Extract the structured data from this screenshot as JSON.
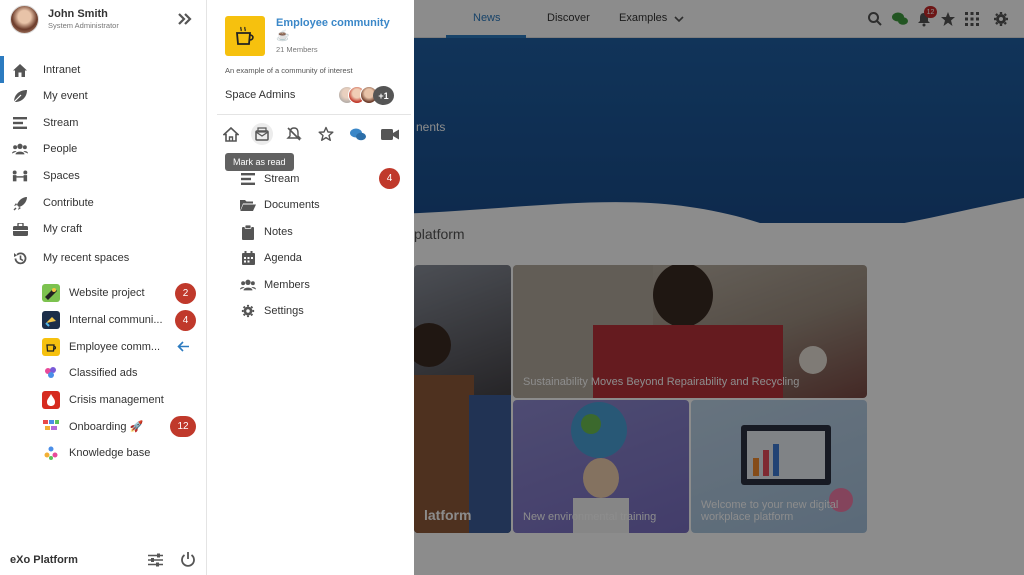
{
  "topbar": {
    "nav": [
      {
        "label": "News",
        "active": true
      },
      {
        "label": "Discover",
        "active": false
      },
      {
        "label": "Examples",
        "active": false
      }
    ],
    "notifications_count": "12"
  },
  "background": {
    "banner_text": "nents",
    "platform_text": "platform",
    "tiles": [
      {
        "caption": "Sustainability Moves Beyond Repairability and Recycling"
      },
      {
        "caption": "New environmental training"
      },
      {
        "caption": "Welcome to your new digital workplace platform"
      },
      {
        "caption": "latform"
      }
    ]
  },
  "user": {
    "name": "John Smith",
    "role": "System Administrator"
  },
  "sidebar": {
    "items": [
      {
        "label": "Intranet",
        "icon": "home-icon"
      },
      {
        "label": "My event",
        "icon": "leaf-icon"
      },
      {
        "label": "Stream",
        "icon": "stream-icon"
      },
      {
        "label": "People",
        "icon": "people-icon"
      },
      {
        "label": "Spaces",
        "icon": "spaces-icon"
      },
      {
        "label": "Contribute",
        "icon": "rocket-icon"
      },
      {
        "label": "My craft",
        "icon": "briefcase-icon"
      },
      {
        "label": "My recent spaces",
        "icon": "history-icon"
      }
    ],
    "recent_spaces": [
      {
        "label": "Website project",
        "badge": "2"
      },
      {
        "label": "Internal communi...",
        "badge": "4"
      },
      {
        "label": "Employee comm...",
        "badge": ""
      },
      {
        "label": "Classified ads",
        "badge": ""
      },
      {
        "label": "Crisis management",
        "badge": ""
      },
      {
        "label": "Onboarding 🚀",
        "badge": "12"
      },
      {
        "label": "Knowledge base",
        "badge": ""
      }
    ],
    "footer_brand": "eXo Platform"
  },
  "space_panel": {
    "title": "Employee community",
    "emoji": "☕",
    "members": "21 Members",
    "description": "An example of a community of interest",
    "admins_label": "Space Admins",
    "admins_more": "+1",
    "tooltip": "Mark as read",
    "nav": [
      {
        "label": "Stream",
        "badge": "4"
      },
      {
        "label": "Documents"
      },
      {
        "label": "Notes"
      },
      {
        "label": "Agenda"
      },
      {
        "label": "Members"
      },
      {
        "label": "Settings"
      }
    ]
  },
  "colors": {
    "accent": "#2c7bc0",
    "badge_red": "#c0392b",
    "space_yellow": "#f6c10e"
  }
}
